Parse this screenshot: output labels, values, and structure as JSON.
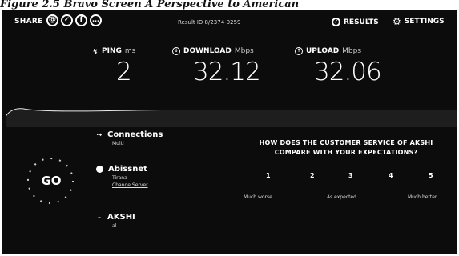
{
  "caption": "Figure 2.5 Bravo Screen A Perspective to American",
  "topbar": {
    "share_label": "SHARE",
    "share_icons": [
      "@",
      "✓",
      "f",
      "…"
    ],
    "result_id": "Result ID 8/2374-0259",
    "results_label": "RESULTS",
    "settings_label": "SETTINGS"
  },
  "metrics": {
    "ping": {
      "label": "PING",
      "unit": "ms",
      "value": "2"
    },
    "download": {
      "label": "DOWNLOAD",
      "unit": "Mbps",
      "value": "32.12"
    },
    "upload": {
      "label": "UPLOAD",
      "unit": "Mbps",
      "value": "32.06"
    }
  },
  "go_label": "GO",
  "connections": {
    "title": "Connections",
    "sub": "Multi"
  },
  "isp": {
    "title": "Abissnet",
    "sub1": "Tirana",
    "sub2": "Change Server"
  },
  "host": {
    "title": "AKSHI",
    "sub": "al"
  },
  "survey": {
    "question": "HOW DOES THE CUSTOMER SERVICE OF AKSHI COMPARE WITH YOUR EXPECTATIONS?",
    "scale": [
      "1",
      "2",
      "3",
      "4",
      "5"
    ],
    "low_label": "Much worse",
    "mid_label": "As expected",
    "high_label": "Much better"
  },
  "colors": {
    "background": "#0c0c0c",
    "text": "#ffffff",
    "caption": "#111111"
  }
}
